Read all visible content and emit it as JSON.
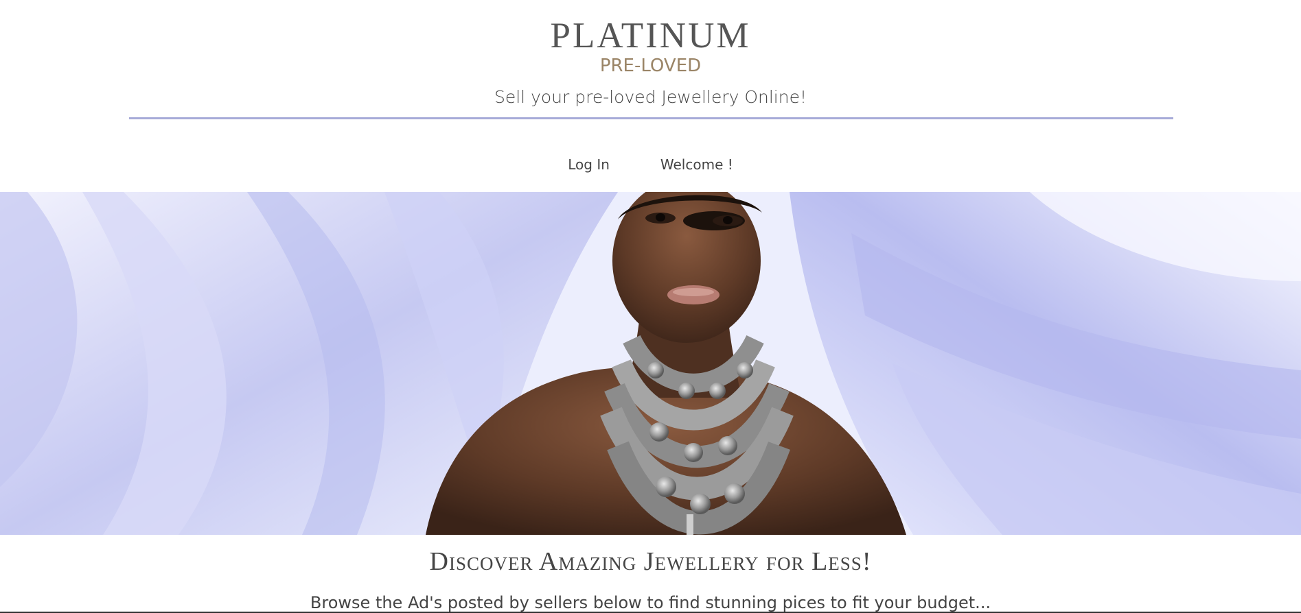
{
  "header": {
    "brand_title": "PLATINUM",
    "brand_subtitle": "PRE-LOVED",
    "tagline": "Sell your pre-loved Jewellery Online!"
  },
  "nav": {
    "items": [
      {
        "label": "Log In"
      },
      {
        "label": "Welcome !"
      }
    ]
  },
  "hero": {
    "image": "model-with-silver-beaded-necklace-and-lavender-silk"
  },
  "section": {
    "title": "Discover Amazing Jewellery for Less!",
    "description": "Browse the Ad's posted by sellers below to find stunning pices to fit your budget..."
  },
  "colors": {
    "accent_line": "#a7abd8",
    "subtitle_gold": "#9a8466",
    "silk_lavender": "#b8bcef"
  }
}
